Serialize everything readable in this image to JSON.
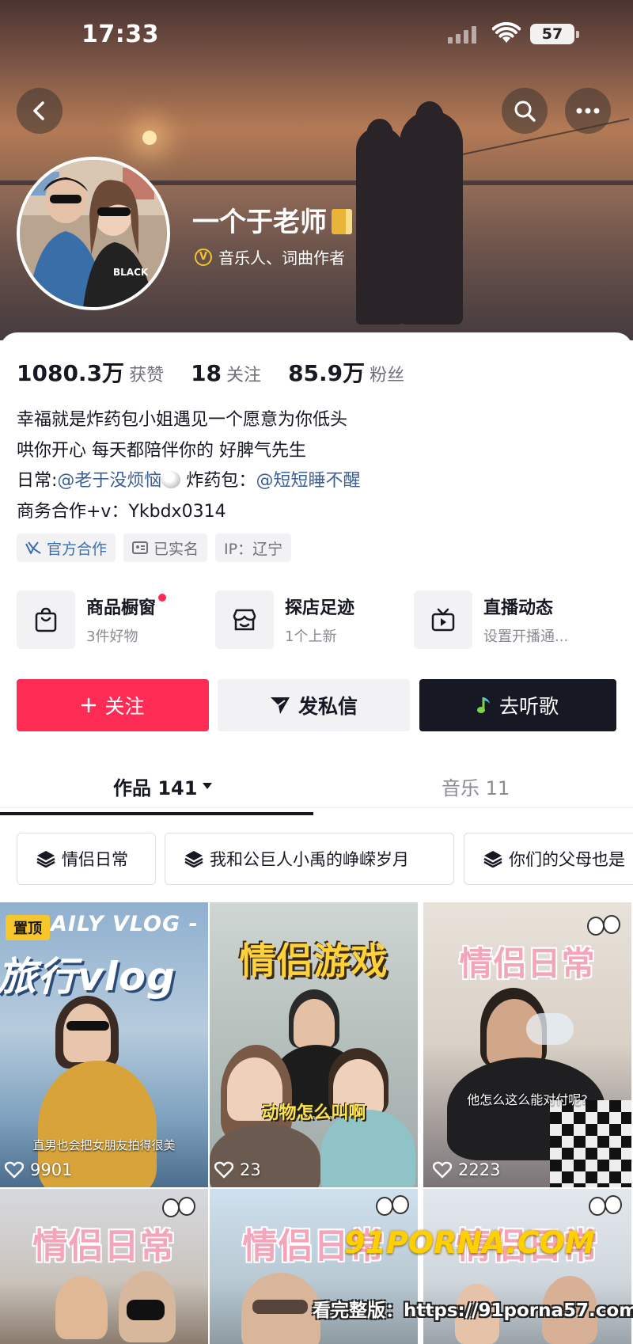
{
  "status_bar": {
    "time": "17:33",
    "battery": "57"
  },
  "profile": {
    "name": "一个于老师",
    "verification": "音乐人、词曲作者"
  },
  "stats": [
    {
      "value": "1080.3万",
      "label": "获赞"
    },
    {
      "value": "18",
      "label": "关注"
    },
    {
      "value": "85.9万",
      "label": "粉丝"
    }
  ],
  "bio": {
    "line1": "幸福就是炸药包小姐遇见一个愿意为你低头",
    "line2": "哄你开心 每天都陪伴你的 好脾气先生",
    "line3_prefix": "日常:",
    "line3_mention1": "@老于没烦恼",
    "line3_middle": " 炸药包：",
    "line3_mention2": "@短短睡不醒",
    "line4": "商务合作+v：Ykbdx0314"
  },
  "tags": [
    {
      "label": "官方合作",
      "icon": "handshake-icon"
    },
    {
      "label": "已实名",
      "icon": "id-card-icon"
    },
    {
      "label": "IP：辽宁"
    }
  ],
  "features": [
    {
      "title": "商品橱窗",
      "subtitle": "3件好物",
      "icon": "shopping-bag-icon",
      "has_dot": true
    },
    {
      "title": "探店足迹",
      "subtitle": "1个上新",
      "icon": "store-icon"
    },
    {
      "title": "直播动态",
      "subtitle": "设置开播通...",
      "icon": "tv-icon"
    }
  ],
  "actions": {
    "follow": "关注",
    "message": "发私信",
    "listen": "去听歌"
  },
  "tabs": {
    "works": "作品 141",
    "music": "音乐 11"
  },
  "collections": [
    "情侣日常",
    "我和公巨人小禹的峥嵘岁月",
    "你们的父母也是"
  ],
  "videos": [
    {
      "title": "旅行vlog",
      "header": "AILY VLOG -",
      "pinned": "置顶",
      "subtitle": "直男也会把女朋友拍得很美",
      "likes": "9901"
    },
    {
      "title": "情侣游戏",
      "subtitle": "动物怎么叫啊",
      "likes": "23"
    },
    {
      "title": "情侣日常",
      "subtitle": "他怎么这么能对付呢?",
      "likes": "2223"
    },
    {
      "title": "情侣日常"
    },
    {
      "title": "情侣日常"
    },
    {
      "title": "情侣日常"
    }
  ],
  "watermark": {
    "logo": "91PORNA.COM",
    "line": "看完整版：https://91porna57.com"
  },
  "colors": {
    "accent_red": "#fe2c55",
    "dark": "#161823",
    "mention_blue": "#3d5f98",
    "pin_yellow": "#f7c62a"
  }
}
